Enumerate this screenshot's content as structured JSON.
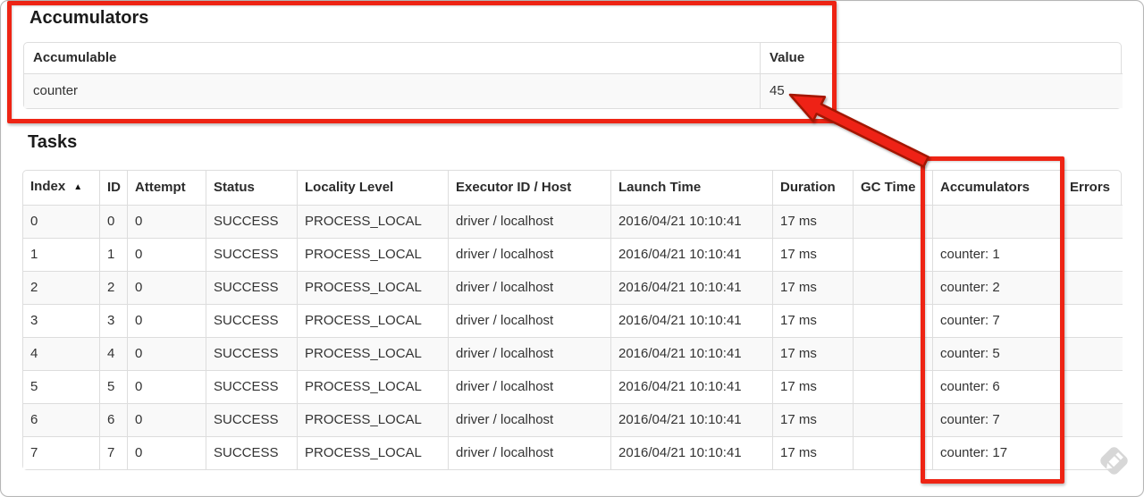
{
  "accumulators": {
    "title": "Accumulators",
    "columns": [
      "Accumulable",
      "Value"
    ],
    "rows": [
      [
        "counter",
        "45"
      ]
    ]
  },
  "tasks": {
    "title": "Tasks",
    "sort_icon": "▲",
    "columns": [
      "Index",
      "ID",
      "Attempt",
      "Status",
      "Locality Level",
      "Executor ID / Host",
      "Launch Time",
      "Duration",
      "GC Time",
      "Accumulators",
      "Errors"
    ],
    "rows": [
      [
        "0",
        "0",
        "0",
        "SUCCESS",
        "PROCESS_LOCAL",
        "driver / localhost",
        "2016/04/21 10:10:41",
        "17 ms",
        "",
        "",
        ""
      ],
      [
        "1",
        "1",
        "0",
        "SUCCESS",
        "PROCESS_LOCAL",
        "driver / localhost",
        "2016/04/21 10:10:41",
        "17 ms",
        "",
        "counter: 1",
        ""
      ],
      [
        "2",
        "2",
        "0",
        "SUCCESS",
        "PROCESS_LOCAL",
        "driver / localhost",
        "2016/04/21 10:10:41",
        "17 ms",
        "",
        "counter: 2",
        ""
      ],
      [
        "3",
        "3",
        "0",
        "SUCCESS",
        "PROCESS_LOCAL",
        "driver / localhost",
        "2016/04/21 10:10:41",
        "17 ms",
        "",
        "counter: 7",
        ""
      ],
      [
        "4",
        "4",
        "0",
        "SUCCESS",
        "PROCESS_LOCAL",
        "driver / localhost",
        "2016/04/21 10:10:41",
        "17 ms",
        "",
        "counter: 5",
        ""
      ],
      [
        "5",
        "5",
        "0",
        "SUCCESS",
        "PROCESS_LOCAL",
        "driver / localhost",
        "2016/04/21 10:10:41",
        "17 ms",
        "",
        "counter: 6",
        ""
      ],
      [
        "6",
        "6",
        "0",
        "SUCCESS",
        "PROCESS_LOCAL",
        "driver / localhost",
        "2016/04/21 10:10:41",
        "17 ms",
        "",
        "counter: 7",
        ""
      ],
      [
        "7",
        "7",
        "0",
        "SUCCESS",
        "PROCESS_LOCAL",
        "driver / localhost",
        "2016/04/21 10:10:41",
        "17 ms",
        "",
        "counter: 17",
        ""
      ]
    ]
  },
  "annotations": {
    "highlight_color": "#ee2414",
    "watermark_color": "#d7d7d7"
  }
}
